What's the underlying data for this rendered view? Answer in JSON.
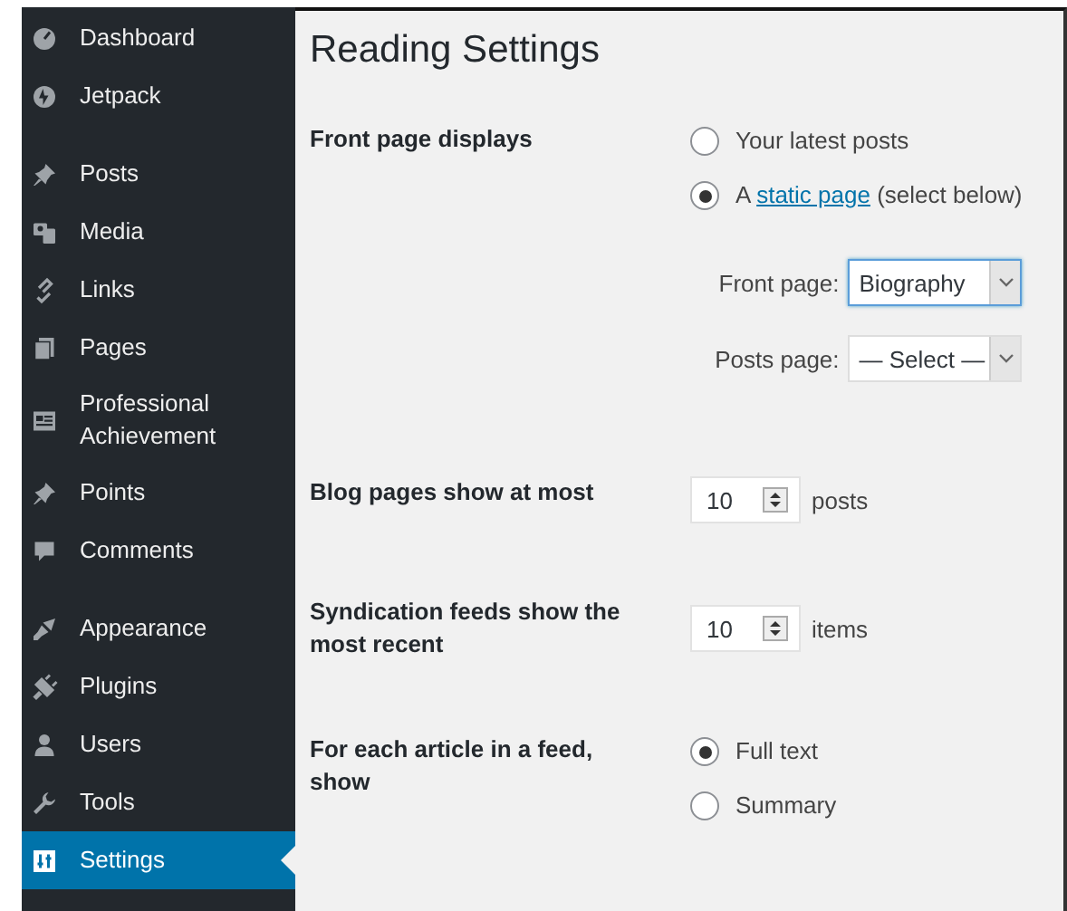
{
  "sidebar": {
    "groups": [
      {
        "items": [
          {
            "label": "Dashboard",
            "selected": false
          },
          {
            "label": "Jetpack",
            "selected": false
          }
        ]
      },
      {
        "items": [
          {
            "label": "Posts",
            "selected": false
          },
          {
            "label": "Media",
            "selected": false
          },
          {
            "label": "Links",
            "selected": false
          },
          {
            "label": "Pages",
            "selected": false
          },
          {
            "label": "Professional Achievement",
            "selected": false
          },
          {
            "label": "Points",
            "selected": false
          },
          {
            "label": "Comments",
            "selected": false
          }
        ]
      },
      {
        "items": [
          {
            "label": "Appearance",
            "selected": false
          },
          {
            "label": "Plugins",
            "selected": false
          },
          {
            "label": "Users",
            "selected": false
          },
          {
            "label": "Tools",
            "selected": false
          },
          {
            "label": "Settings",
            "selected": true
          }
        ]
      }
    ]
  },
  "page": {
    "title": "Reading Settings",
    "rows": [
      {
        "kind": "radios",
        "label": "Front page displays",
        "options": [
          {
            "text": "Your latest posts",
            "selected": false
          },
          {
            "text": "A ",
            "link": "static page",
            "after": " (select below)",
            "selected": true
          }
        ],
        "selects": [
          {
            "label": "Front page:",
            "value": "Biography",
            "focused": true
          },
          {
            "label": "Posts page:",
            "value": "— Select —",
            "focused": false
          }
        ]
      },
      {
        "kind": "number",
        "label": "Blog pages show at most",
        "value": "10",
        "unit": "posts"
      },
      {
        "kind": "number",
        "label": "Syndication feeds show the most recent",
        "value": "10",
        "unit": "items"
      },
      {
        "kind": "radios",
        "label": "For each article in a feed, show",
        "options": [
          {
            "text": "Full text",
            "selected": true
          },
          {
            "text": "Summary",
            "selected": false
          }
        ]
      }
    ]
  }
}
